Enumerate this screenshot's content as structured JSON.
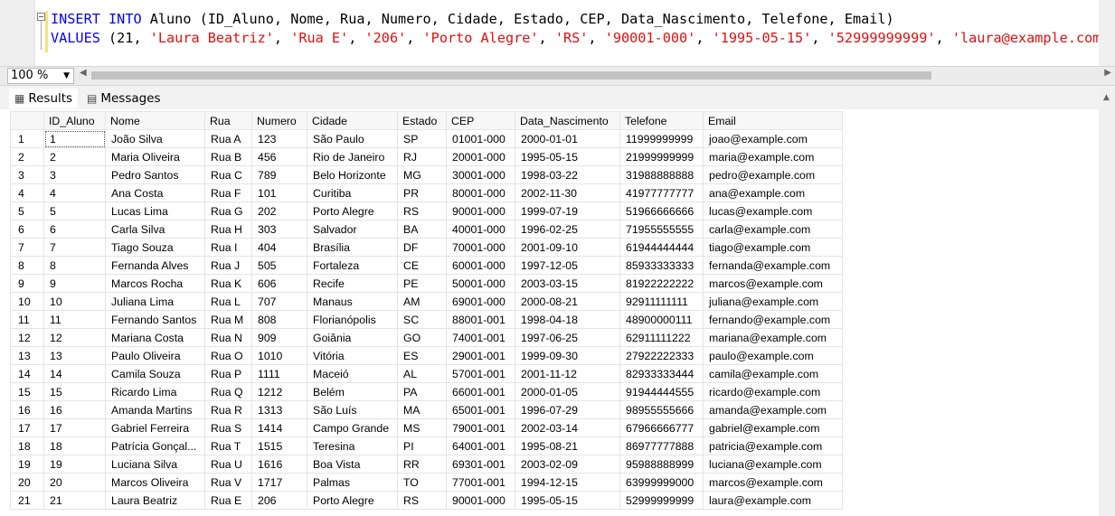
{
  "editor": {
    "line1_kw1": "INSERT",
    "line1_kw2": "INTO",
    "line1_rest": " Aluno (ID_Aluno, Nome, Rua, Numero, Cidade, Estado, CEP, Data_Nascimento, Telefone, Email)",
    "line2_kw": "VALUES",
    "line2_open": " (21, ",
    "values": [
      "'Laura Beatriz'",
      "'Rua E'",
      "'206'",
      "'Porto Alegre'",
      "'RS'",
      "'90001-000'",
      "'1995-05-15'",
      "'52999999999'",
      "'laura@example.com'"
    ],
    "sep": ", ",
    "close": ");"
  },
  "zoom": {
    "value": "100 %"
  },
  "tabs": {
    "results": "Results",
    "messages": "Messages"
  },
  "table": {
    "columns": [
      "ID_Aluno",
      "Nome",
      "Rua",
      "Numero",
      "Cidade",
      "Estado",
      "CEP",
      "Data_Nascimento",
      "Telefone",
      "Email"
    ],
    "rows": [
      [
        "1",
        "João Silva",
        "Rua A",
        "123",
        "São Paulo",
        "SP",
        "01001-000",
        "2000-01-01",
        "11999999999",
        "joao@example.com"
      ],
      [
        "2",
        "Maria Oliveira",
        "Rua B",
        "456",
        "Rio de Janeiro",
        "RJ",
        "20001-000",
        "1995-05-15",
        "21999999999",
        "maria@example.com"
      ],
      [
        "3",
        "Pedro Santos",
        "Rua C",
        "789",
        "Belo Horizonte",
        "MG",
        "30001-000",
        "1998-03-22",
        "31988888888",
        "pedro@example.com"
      ],
      [
        "4",
        "Ana Costa",
        "Rua F",
        "101",
        "Curitiba",
        "PR",
        "80001-000",
        "2002-11-30",
        "41977777777",
        "ana@example.com"
      ],
      [
        "5",
        "Lucas Lima",
        "Rua G",
        "202",
        "Porto Alegre",
        "RS",
        "90001-000",
        "1999-07-19",
        "51966666666",
        "lucas@example.com"
      ],
      [
        "6",
        "Carla Silva",
        "Rua H",
        "303",
        "Salvador",
        "BA",
        "40001-000",
        "1996-02-25",
        "71955555555",
        "carla@example.com"
      ],
      [
        "7",
        "Tiago Souza",
        "Rua I",
        "404",
        "Brasília",
        "DF",
        "70001-000",
        "2001-09-10",
        "61944444444",
        "tiago@example.com"
      ],
      [
        "8",
        "Fernanda Alves",
        "Rua J",
        "505",
        "Fortaleza",
        "CE",
        "60001-000",
        "1997-12-05",
        "85933333333",
        "fernanda@example.com"
      ],
      [
        "9",
        "Marcos Rocha",
        "Rua K",
        "606",
        "Recife",
        "PE",
        "50001-000",
        "2003-03-15",
        "81922222222",
        "marcos@example.com"
      ],
      [
        "10",
        "Juliana Lima",
        "Rua L",
        "707",
        "Manaus",
        "AM",
        "69001-000",
        "2000-08-21",
        "92911111111",
        "juliana@example.com"
      ],
      [
        "11",
        "Fernando Santos",
        "Rua M",
        "808",
        "Florianópolis",
        "SC",
        "88001-001",
        "1998-04-18",
        "48900000111",
        "fernando@example.com"
      ],
      [
        "12",
        "Mariana Costa",
        "Rua N",
        "909",
        "Goiânia",
        "GO",
        "74001-001",
        "1997-06-25",
        "62911111222",
        "mariana@example.com"
      ],
      [
        "13",
        "Paulo Oliveira",
        "Rua O",
        "1010",
        "Vitória",
        "ES",
        "29001-001",
        "1999-09-30",
        "27922222333",
        "paulo@example.com"
      ],
      [
        "14",
        "Camila Souza",
        "Rua P",
        "1111",
        "Maceió",
        "AL",
        "57001-001",
        "2001-11-12",
        "82933333444",
        "camila@example.com"
      ],
      [
        "15",
        "Ricardo Lima",
        "Rua Q",
        "1212",
        "Belém",
        "PA",
        "66001-001",
        "2000-01-05",
        "91944444555",
        "ricardo@example.com"
      ],
      [
        "16",
        "Amanda Martins",
        "Rua R",
        "1313",
        "São Luís",
        "MA",
        "65001-001",
        "1996-07-29",
        "98955555666",
        "amanda@example.com"
      ],
      [
        "17",
        "Gabriel Ferreira",
        "Rua S",
        "1414",
        "Campo Grande",
        "MS",
        "79001-001",
        "2002-03-14",
        "67966666777",
        "gabriel@example.com"
      ],
      [
        "18",
        "Patrícia Gonçal...",
        "Rua T",
        "1515",
        "Teresina",
        "PI",
        "64001-001",
        "1995-08-21",
        "86977777888",
        "patricia@example.com"
      ],
      [
        "19",
        "Luciana Silva",
        "Rua U",
        "1616",
        "Boa Vista",
        "RR",
        "69301-001",
        "2003-02-09",
        "95988888999",
        "luciana@example.com"
      ],
      [
        "20",
        "Marcos Oliveira",
        "Rua V",
        "1717",
        "Palmas",
        "TO",
        "77001-001",
        "1994-12-15",
        "63999999000",
        "marcos@example.com"
      ],
      [
        "21",
        "Laura Beatriz",
        "Rua E",
        "206",
        "Porto Alegre",
        "RS",
        "90001-000",
        "1995-05-15",
        "52999999999",
        "laura@example.com"
      ]
    ]
  }
}
